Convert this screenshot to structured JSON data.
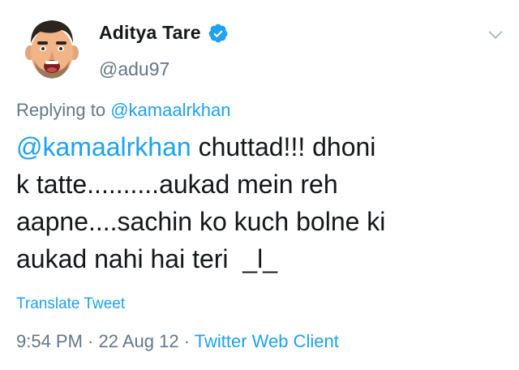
{
  "author": {
    "display_name": "Aditya Tare",
    "handle": "@adu97",
    "avatar_icon": "cartoon-avatar-icon",
    "verified_icon": "verified-badge-icon"
  },
  "reply": {
    "prefix": "Replying to",
    "target": "@kamaalrkhan"
  },
  "tweet": {
    "mention": "@kamaalrkhan",
    "line1_rest": " chuttad!!! dhoni",
    "line2": "k tatte..........aukad mein reh",
    "line3": "aapne....sachin ko kuch bolne ki",
    "line4": "aukad nahi hai teri  _l_"
  },
  "actions": {
    "translate_label": "Translate Tweet",
    "menu_icon": "chevron-down-icon"
  },
  "meta": {
    "time": "9:54 PM",
    "sep1": " · ",
    "date": "22 Aug 12",
    "sep2": " · ",
    "source": "Twitter Web Client"
  },
  "colors": {
    "link": "#1da1f2",
    "secondary": "#657786",
    "text": "#14171a"
  }
}
